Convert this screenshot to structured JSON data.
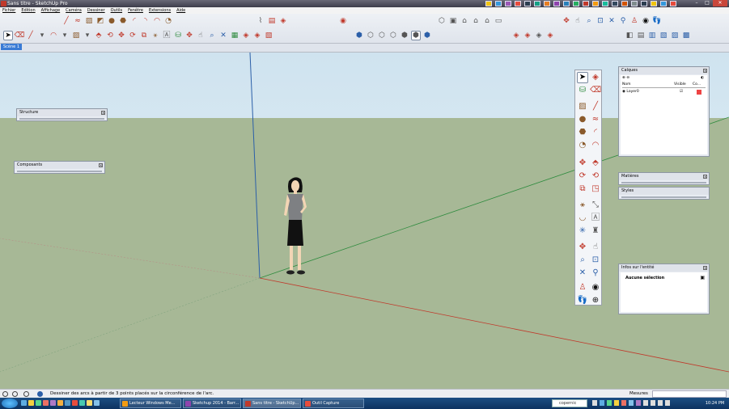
{
  "window": {
    "title": "Sans titre - SketchUp Pro",
    "window_buttons": [
      "–",
      "□",
      "✕"
    ]
  },
  "menu": [
    "Fichier",
    "Edition",
    "Affichage",
    "Caméra",
    "Dessiner",
    "Outils",
    "Fenêtre",
    "Extensions",
    "Aide"
  ],
  "scene_tab": "Scène 1",
  "trays": {
    "structure": "Structure",
    "composants": "Composants",
    "calques": {
      "title": "Calques",
      "col_name": "Nom",
      "col_visible": "Visible",
      "col_color": "Co...",
      "layer_name": "Layer0",
      "layer_color": "#ee4444"
    },
    "matieres": "Matières",
    "styles": "Styles",
    "infos": {
      "title": "Infos sur l'entité",
      "selection": "Aucune sélection"
    }
  },
  "status": {
    "message": "Dessiner des arcs à partir de 3 points placés sur la circonférence de l'arc.",
    "measure_label": "Mesures"
  },
  "taskbar": {
    "tasks": [
      "Lecteur Windows Me...",
      "Sketchup 2014 - Barr...",
      "Sans titre - SketchUp...",
      "Outil Capture"
    ],
    "search": "copernic",
    "clock": "10:24 PM"
  },
  "colors": {
    "sky": "#cfe3ef",
    "ground": "#a7b896",
    "red_axis": "#c0392b",
    "green_axis": "#2e8b3e",
    "blue_axis": "#2b5fa8"
  }
}
